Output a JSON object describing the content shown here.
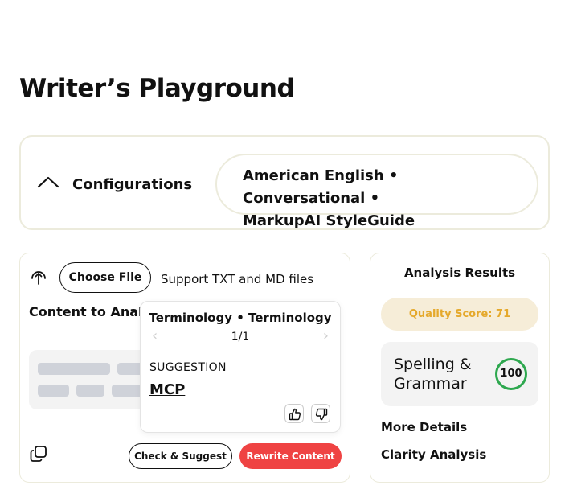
{
  "page": {
    "title": "Writer’s Playground"
  },
  "configurations": {
    "label": "Configurations",
    "summary_line1": "American English • Conversational •",
    "summary_line2": "MarkupAI StyleGuide",
    "toggle_icon": "chevron-up-icon"
  },
  "content": {
    "upload_icon": "upload-icon",
    "choose_file_label": "Choose File",
    "support_text": "Support TXT and MD files",
    "content_label": "Content to Analyze",
    "copy_icon": "copy-icon",
    "check_suggest_label": "Check & Suggest",
    "rewrite_label": "Rewrite Content",
    "rewrite_color": "#ef4343"
  },
  "suggestion_popover": {
    "title": "Terminology • Terminology",
    "counter": "1/1",
    "suggestion_label": "SUGGESTION",
    "suggestion_value": "MCP",
    "prev_icon": "chevron-left-icon",
    "next_icon": "chevron-right-icon",
    "thumbs_up_icon": "thumbs-up-icon",
    "thumbs_down_icon": "thumbs-down-icon"
  },
  "analysis": {
    "title": "Analysis Results",
    "quality_score": "Quality Score: 71",
    "quality_color": "#e5a92c",
    "spelling_label_line1": "Spelling &",
    "spelling_label_line2": "Grammar",
    "spelling_score": "100",
    "spelling_color": "#2ea84f",
    "more_details": "More Details",
    "clarity": "Clarity Analysis"
  }
}
